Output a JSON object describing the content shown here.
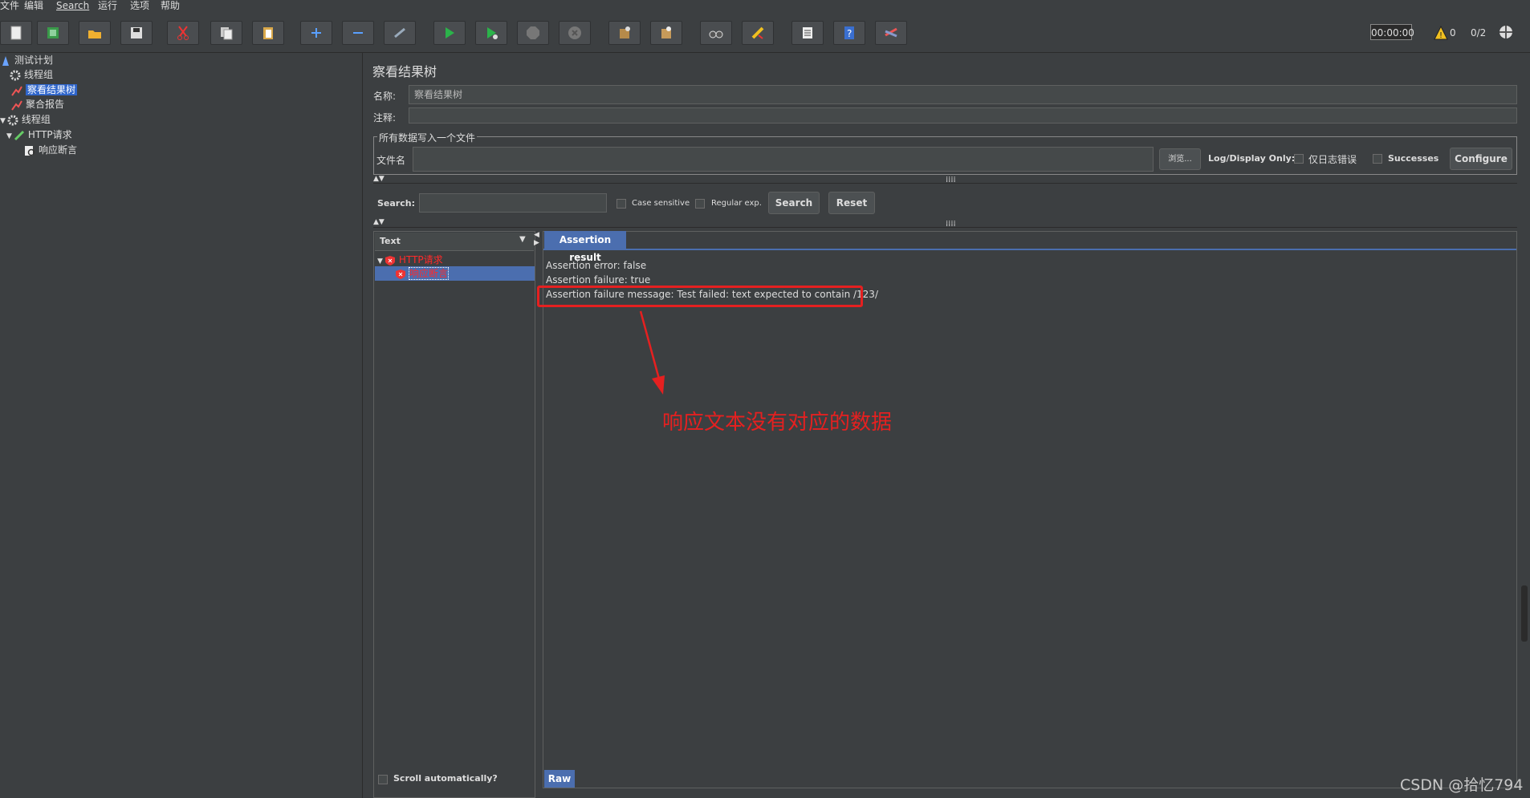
{
  "menubar": {
    "items": [
      "文件",
      "编辑",
      "Search",
      "运行",
      "选项",
      "帮助"
    ]
  },
  "toolbar": {
    "buttons": [
      "new-icon",
      "template-icon",
      "open-icon",
      "save-icon",
      "cut-icon",
      "copy-icon",
      "paste-icon",
      "expand-icon",
      "collapse-icon",
      "toggle-icon",
      "start-icon",
      "start-no-pause-icon",
      "stop-icon",
      "shutdown-icon",
      "clear-icon",
      "clear-all-icon",
      "search-icon",
      "reset-search-icon",
      "function-helper-icon",
      "help-icon",
      "remote-icon"
    ],
    "timer": "00:00:00",
    "warning_count": "0",
    "thread_count": "0/2"
  },
  "tree": {
    "nodes": [
      {
        "label": "测试计划",
        "icon": "test-plan-icon"
      },
      {
        "label": "线程组",
        "icon": "thread-group-icon"
      },
      {
        "label": "察看结果树",
        "icon": "listener-icon",
        "selected": true
      },
      {
        "label": "聚合报告",
        "icon": "listener-icon"
      },
      {
        "label": "线程组",
        "icon": "thread-group-icon"
      },
      {
        "label": "HTTP请求",
        "icon": "sampler-icon"
      },
      {
        "label": "响应断言",
        "icon": "assertion-icon"
      }
    ]
  },
  "panel": {
    "title": "察看结果树",
    "name_label": "名称:",
    "name_value": "察看结果树",
    "comment_label": "注释:",
    "file_group_title": "所有数据写入一个文件",
    "filename_label": "文件名",
    "browse_label": "浏览...",
    "log_display_label": "Log/Display Only:",
    "errors_only_label": "仅日志错误",
    "successes_label": "Successes",
    "configure_label": "Configure"
  },
  "search": {
    "label": "Search:",
    "case_sensitive_label": "Case sensitive",
    "regex_label": "Regular exp.",
    "search_button": "Search",
    "reset_button": "Reset"
  },
  "results": {
    "renderer_label": "Text",
    "items": [
      {
        "label": "HTTP请求",
        "status": "failed"
      },
      {
        "label": "响应断言",
        "status": "failed",
        "selected": true
      }
    ],
    "tab_label": "Assertion result",
    "lines": [
      "Assertion error: false",
      "Assertion failure: true",
      "Assertion failure message: Test failed: text expected to contain /123/"
    ],
    "scroll_label": "Scroll automatically?",
    "raw_tab": "Raw"
  },
  "annotation": {
    "text": "响应文本没有对应的数据",
    "color": "#e52020"
  },
  "watermark": "CSDN @拾忆794",
  "colors": {
    "background": "#3c3f41",
    "selection": "#2f65ca",
    "tab": "#4b6eaf",
    "error": "#ff2a2a"
  }
}
